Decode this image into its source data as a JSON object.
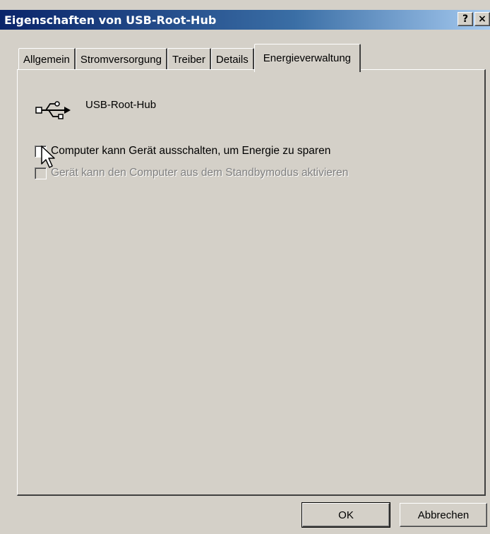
{
  "window": {
    "title": "Eigenschaften von USB-Root-Hub",
    "help_button": "?",
    "close_button": "×"
  },
  "tabs": [
    {
      "label": "Allgemein",
      "active": false
    },
    {
      "label": "Stromversorgung",
      "active": false
    },
    {
      "label": "Treiber",
      "active": false
    },
    {
      "label": "Details",
      "active": false
    },
    {
      "label": "Energieverwaltung",
      "active": true
    }
  ],
  "device": {
    "icon": "usb-icon",
    "name": "USB-Root-Hub"
  },
  "options": [
    {
      "label": "Computer kann Gerät ausschalten, um Energie zu sparen",
      "checked": false,
      "enabled": true
    },
    {
      "label": "Gerät kann den Computer aus dem Standbymodus aktivieren",
      "checked": false,
      "enabled": false
    }
  ],
  "buttons": {
    "ok": "OK",
    "cancel": "Abbrechen"
  }
}
